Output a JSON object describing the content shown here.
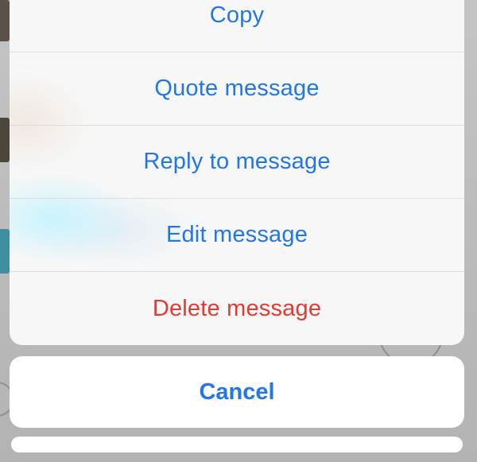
{
  "action_sheet": {
    "actions": [
      {
        "label": "Copy",
        "style": "default"
      },
      {
        "label": "Quote message",
        "style": "default"
      },
      {
        "label": "Reply to message",
        "style": "default"
      },
      {
        "label": "Edit message",
        "style": "default"
      },
      {
        "label": "Delete message",
        "style": "destructive"
      }
    ],
    "cancel_label": "Cancel"
  },
  "colors": {
    "action_text": "#2277e6",
    "destructive_text": "#e53a2f",
    "sheet_background": "#f7f7f7",
    "cancel_background": "#ffffff",
    "dimmed_background": "#bdbdbd"
  }
}
